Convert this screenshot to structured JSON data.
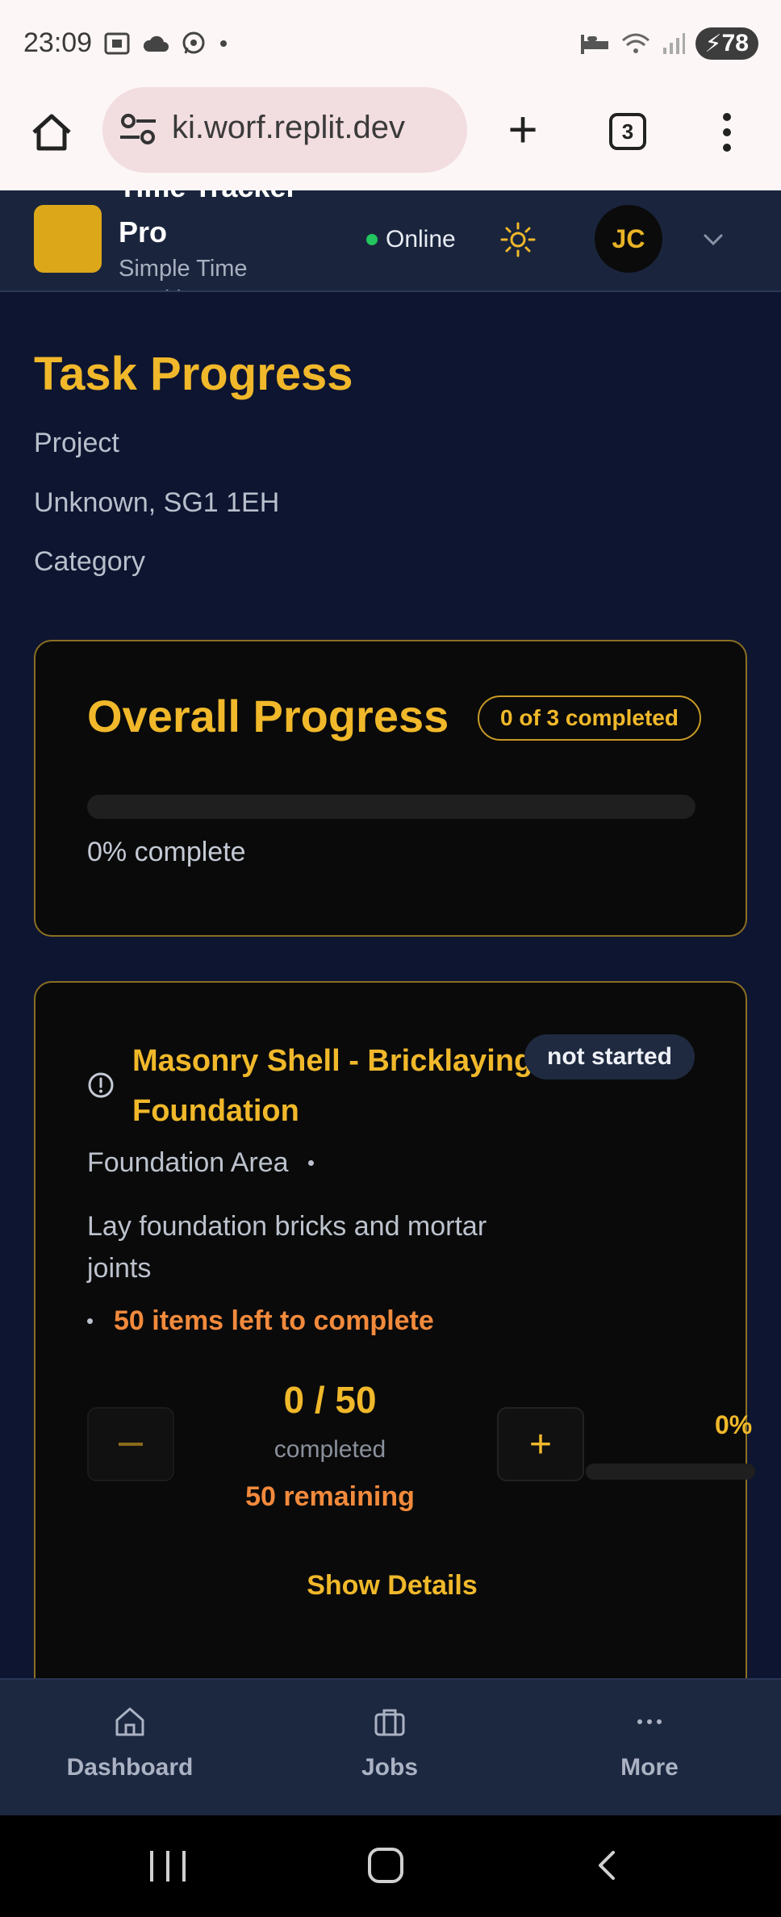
{
  "status_bar": {
    "time": "23:09",
    "battery": "78"
  },
  "browser": {
    "url": "ki.worf.replit.dev",
    "tab_count": "3"
  },
  "header": {
    "app_name": "Time Tracker Pro",
    "app_subtitle": "Simple Time Tracking",
    "connection_status": "Online",
    "avatar_initials": "JC",
    "colors": {
      "logo": "#dca81a",
      "online_dot": "#22c55e"
    }
  },
  "page": {
    "title": "Task Progress",
    "project_label": "Project",
    "location": "Unknown, SG1 1EH",
    "category_label": "Category"
  },
  "overall": {
    "title": "Overall Progress",
    "badge": "0 of 3 completed",
    "progress_fraction": 0,
    "percent_text": "0% complete"
  },
  "task": {
    "icon": "alert-circle-icon",
    "title": "Masonry Shell - Bricklaying Foundation",
    "status": "not started",
    "area": "Foundation Area",
    "description": "Lay foundation bricks and mortar joints",
    "items_left": "50 items left to complete",
    "count": "0 / 50",
    "completed_label": "completed",
    "remaining": "50 remaining",
    "percent": "0%",
    "progress_fraction": 0,
    "show_details": "Show Details"
  },
  "bottom_nav": {
    "items": [
      {
        "label": "Dashboard",
        "icon": "home-icon"
      },
      {
        "label": "Jobs",
        "icon": "briefcase-icon"
      },
      {
        "label": "More",
        "icon": "more-horizontal-icon"
      }
    ]
  },
  "theme": {
    "accent": "#f0b82a",
    "warning": "#f28a3c",
    "background": "#0e1530",
    "card": "#0a0a0a"
  }
}
